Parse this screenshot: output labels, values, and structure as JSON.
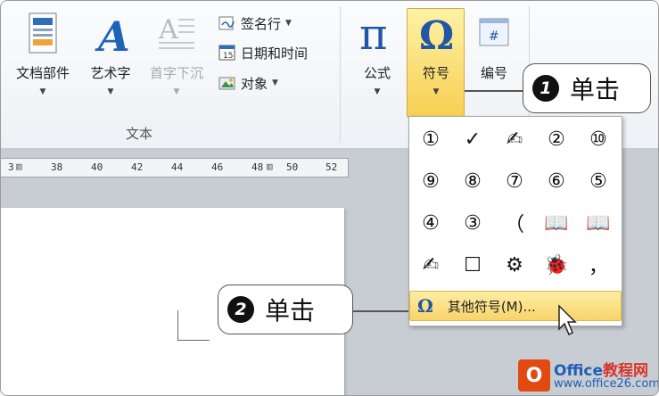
{
  "ribbon": {
    "text_group_label": "文本",
    "buttons": {
      "doc_parts": "文档部件",
      "wordart": "艺术字",
      "dropcap": "首字下沉",
      "equation": "公式",
      "symbol": "符号",
      "number": "编号"
    },
    "small_buttons": {
      "signature": "签名行",
      "datetime": "日期和时间",
      "object": "对象"
    }
  },
  "ruler": {
    "ticks": [
      "3",
      "38",
      "40",
      "42",
      "44",
      "46",
      "48",
      "50",
      "52"
    ]
  },
  "symbol_dropdown": {
    "symbols": [
      [
        "①",
        "✓",
        "✍",
        "②",
        "⑩"
      ],
      [
        "⑨",
        "⑧",
        "⑦",
        "⑥",
        "⑤"
      ],
      [
        "④",
        "③",
        "（",
        "📖",
        "📖"
      ],
      [
        "✍",
        "☐",
        "⚙",
        "🐞",
        "，"
      ]
    ],
    "more_label": "其他符号(M)..."
  },
  "callouts": {
    "step1": {
      "number": "1",
      "text": "单击"
    },
    "step2": {
      "number": "2",
      "text": "单击"
    }
  },
  "watermark": {
    "brand_office": "Office",
    "brand_cn": "教程网",
    "url": "www.office26.com"
  },
  "colors": {
    "highlight_top": "#fdf2a6",
    "highlight_bottom": "#f8cf52",
    "accent_blue": "#2257a5"
  }
}
